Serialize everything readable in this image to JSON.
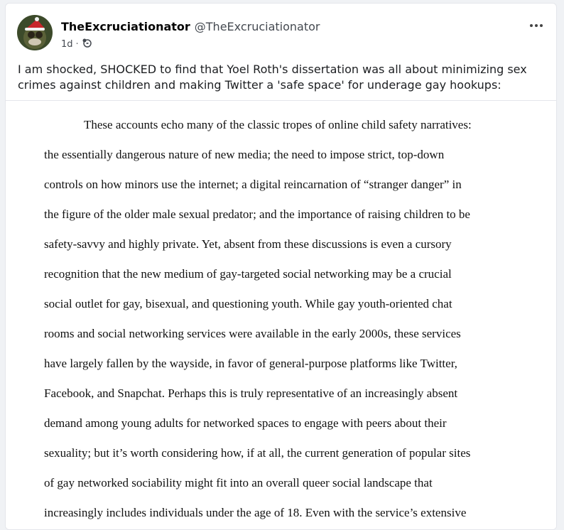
{
  "post": {
    "author_name": "TheExcruciationator",
    "author_handle": "@TheExcruciationator",
    "time": "1d",
    "audience_icon": "audience-icon",
    "more_icon": "more-options-icon",
    "text": "I am shocked, SHOCKED to find that Yoel Roth's dissertation was all about minimizing sex crimes against children and making Twitter a 'safe space' for underage gay hookups:"
  },
  "document": {
    "lines": [
      "These accounts echo many of the classic tropes of online child safety narratives:",
      "the essentially dangerous nature of new media; the need to impose strict, top-down",
      "controls on how minors use the internet; a digital reincarnation of “stranger danger” in",
      "the figure of the older male sexual predator; and the importance of raising children to be",
      "safety-savvy and highly private. Yet, absent from these discussions is even a cursory",
      "recognition that the new medium of gay-targeted social networking may be a crucial",
      "social outlet for gay, bisexual, and questioning youth. While gay youth-oriented chat",
      "rooms and social networking services were available in the early 2000s, these services",
      "have largely fallen by the wayside, in favor of general-purpose platforms like Twitter,",
      "Facebook, and Snapchat. Perhaps this is truly representative of an increasingly absent",
      "demand among young adults for networked spaces to engage with peers about their",
      "sexuality; but it’s worth considering how, if at all, the current generation of popular sites",
      "of gay networked sociability might fit into an overall queer social landscape that",
      "increasingly includes individuals under the age of 18. Even with the service’s extensive"
    ]
  }
}
